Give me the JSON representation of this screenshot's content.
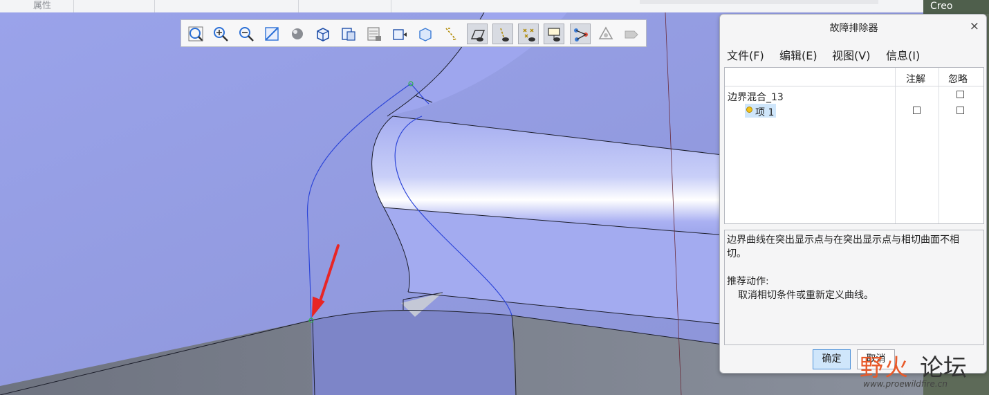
{
  "topbar": {
    "properties_label": "属性",
    "app_badge": "Creo"
  },
  "toolbar": {
    "buttons": [
      {
        "name": "refit-icon"
      },
      {
        "name": "zoom-in-icon"
      },
      {
        "name": "zoom-out-icon"
      },
      {
        "name": "repaint-icon"
      },
      {
        "name": "display-style-icon"
      },
      {
        "name": "saved-orientations-icon"
      },
      {
        "name": "view-manager-icon"
      },
      {
        "name": "layer-icon"
      },
      {
        "name": "named-view-icon"
      },
      {
        "name": "perspective-icon"
      },
      {
        "name": "datum-display-icon"
      },
      {
        "name": "plane-display-icon"
      },
      {
        "name": "axis-display-icon"
      },
      {
        "name": "point-display-icon"
      },
      {
        "name": "csys-display-icon"
      },
      {
        "name": "annotation-display-icon"
      },
      {
        "name": "spin-center-icon"
      },
      {
        "name": "annotation-plane-icon"
      }
    ]
  },
  "dialog": {
    "title": "故障排除器",
    "close": "×",
    "menu": [
      "文件(F)",
      "编辑(E)",
      "视图(V)",
      "信息(I)"
    ],
    "columns": {
      "note": "注解",
      "ignore": "忽略"
    },
    "tree": [
      {
        "label": "边界混合_13",
        "note": null,
        "ignore": false
      },
      {
        "label": "项 1",
        "note": false,
        "ignore": false,
        "selected": true
      }
    ],
    "message_line1": "边界曲线在突出显示点与在突出显示点与相切曲面不相",
    "message_line2": "切。",
    "action_title": "推荐动作:",
    "action_text": "取消相切条件或重新定义曲线。",
    "ok_label": "确定",
    "cancel_label": "取消"
  },
  "watermark": {
    "brand_left": "野火",
    "brand_right": "论坛",
    "url": "www.proewildfire.cn"
  },
  "colors": {
    "model_surface": "#9aa3ea",
    "floor": "#7d838f",
    "curve": "#2c45d8",
    "arrow": "#e82525",
    "accent": "#4a90d9"
  }
}
